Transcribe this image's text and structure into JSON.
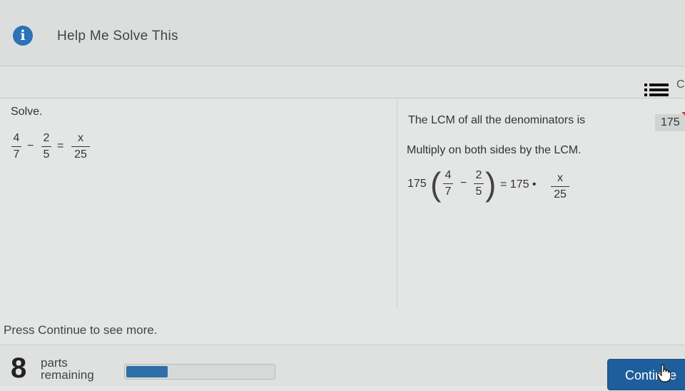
{
  "header": {
    "title": "Help Me Solve This",
    "icon": "info-icon"
  },
  "toolbar": {
    "icon": "list-icon",
    "more_glyph": "C"
  },
  "problem": {
    "prompt": "Solve.",
    "frac1": {
      "num": "4",
      "den": "7"
    },
    "op1": "−",
    "frac2": {
      "num": "2",
      "den": "5"
    },
    "eq": "=",
    "frac3": {
      "num": "x",
      "den": "25"
    }
  },
  "explanation": {
    "lcm_text": "The LCM of all the denominators is",
    "lcm_value": "175",
    "multiply_text": "Multiply on both sides by the LCM.",
    "eq_lhs_coef": "175",
    "eq_frac1": {
      "num": "4",
      "den": "7"
    },
    "eq_op": "−",
    "eq_frac2": {
      "num": "2",
      "den": "5"
    },
    "eq_rhs": "= 175 •",
    "eq_frac3": {
      "num": "x",
      "den": "25"
    }
  },
  "footer": {
    "message": "Press Continue to see more.",
    "parts_count": "8",
    "parts_line1": "parts",
    "parts_line2": "remaining",
    "progress_fraction": 0.28,
    "continue_label": "Continue",
    "accent_color": "#1f5e9c"
  }
}
